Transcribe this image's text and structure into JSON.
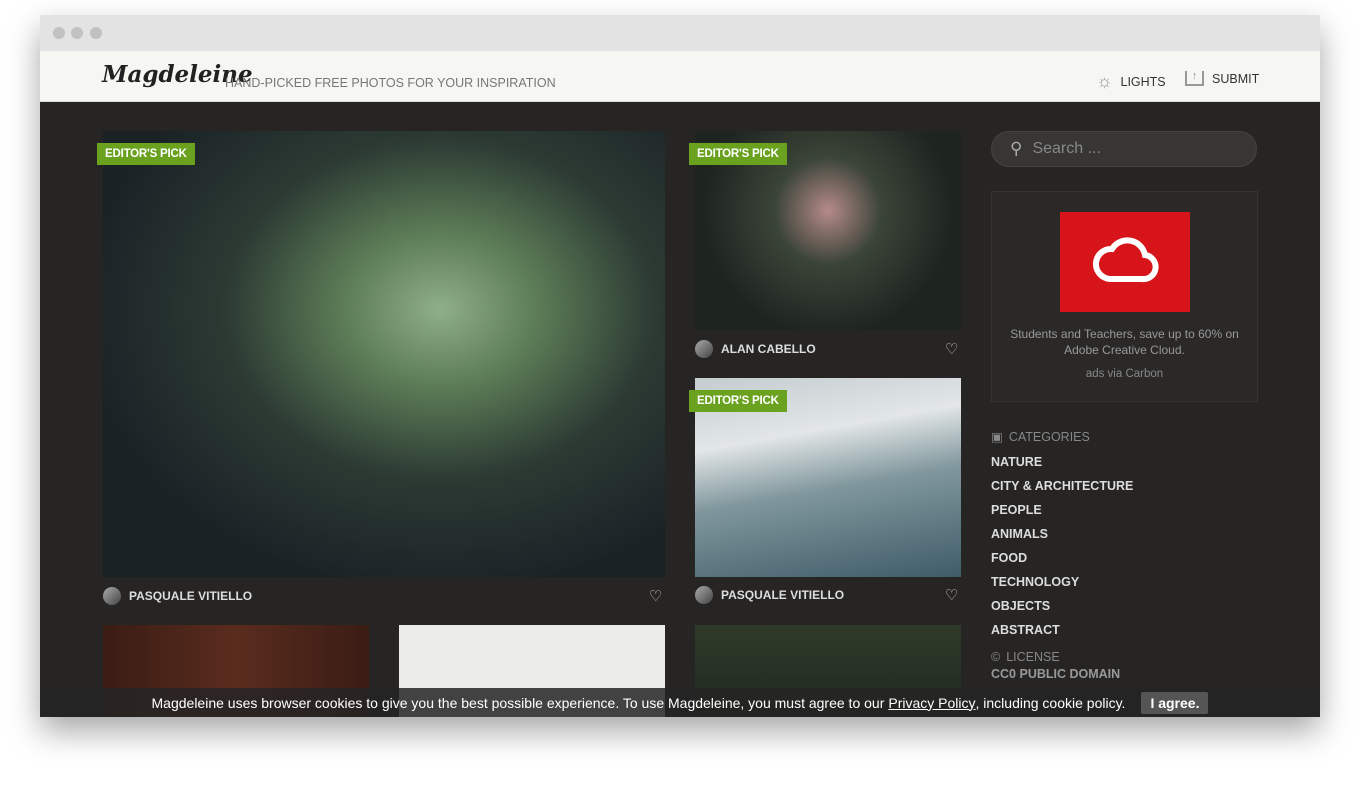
{
  "header": {
    "logo": "Magdeleine",
    "tagline": "HAND-PICKED FREE PHOTOS FOR YOUR INSPIRATION",
    "lights_label": "LIGHTS",
    "submit_label": "SUBMIT"
  },
  "photos": [
    {
      "badge": "EDITOR'S PICK",
      "author": "PASQUALE VITIELLO"
    },
    {
      "badge": "EDITOR'S PICK",
      "author": "ALAN CABELLO"
    },
    {
      "badge": "EDITOR'S PICK",
      "author": "PASQUALE VITIELLO"
    }
  ],
  "sidebar": {
    "search_placeholder": "Search ...",
    "ad": {
      "text": "Students and Teachers, save up to 60% on Adobe Creative Cloud.",
      "via": "ads via Carbon"
    },
    "categories_title": "CATEGORIES",
    "categories": [
      "NATURE",
      "CITY & ARCHITECTURE",
      "PEOPLE",
      "ANIMALS",
      "FOOD",
      "TECHNOLOGY",
      "OBJECTS",
      "ABSTRACT"
    ],
    "license_title": "LICENSE",
    "license_value": "CC0 PUBLIC DOMAIN"
  },
  "cookie": {
    "text": "Magdeleine uses browser cookies to give you the best possible experience. To use Magdeleine, you must agree to our",
    "link": "Privacy Policy",
    "text_after": ", including cookie policy.",
    "button": "I agree."
  },
  "colors": {
    "accent": "#6aa220",
    "background": "#262524",
    "header": "#f6f6f2",
    "ad": "#d7141a"
  }
}
